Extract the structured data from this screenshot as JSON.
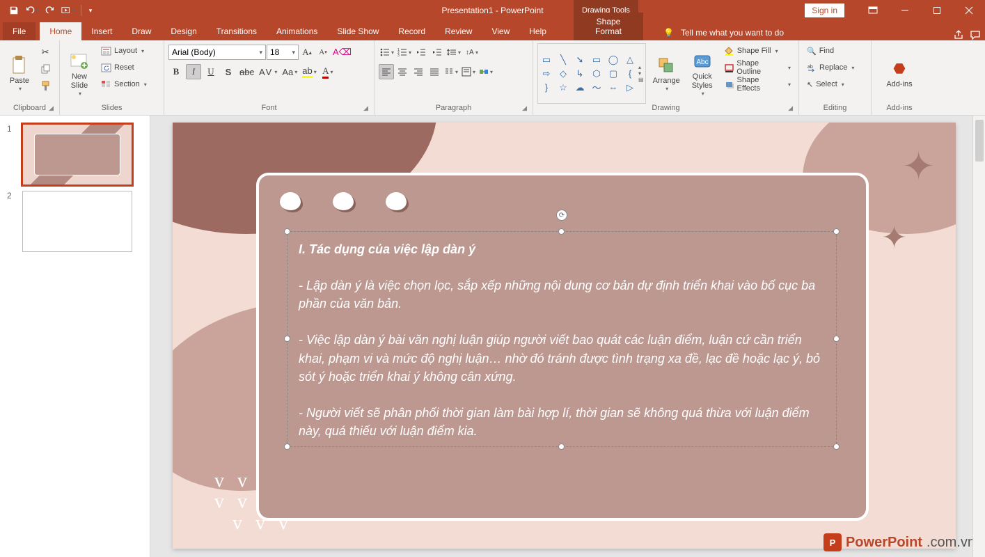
{
  "titlebar": {
    "document_title": "Presentation1 - PowerPoint",
    "context_tab": "Drawing Tools",
    "signin": "Sign in"
  },
  "tabs": {
    "file": "File",
    "items": [
      "Home",
      "Insert",
      "Draw",
      "Design",
      "Transitions",
      "Animations",
      "Slide Show",
      "Record",
      "Review",
      "View",
      "Help"
    ],
    "format": "Shape Format",
    "tellme": "Tell me what you want to do"
  },
  "ribbon": {
    "clipboard": {
      "label": "Clipboard",
      "paste": "Paste"
    },
    "slides": {
      "label": "Slides",
      "new_slide": "New\nSlide",
      "layout": "Layout",
      "reset": "Reset",
      "section": "Section"
    },
    "font": {
      "label": "Font",
      "name": "Arial (Body)",
      "size": "18"
    },
    "paragraph": {
      "label": "Paragraph"
    },
    "drawing": {
      "label": "Drawing",
      "arrange": "Arrange",
      "quick": "Quick\nStyles",
      "fill": "Shape Fill",
      "outline": "Shape Outline",
      "effects": "Shape Effects"
    },
    "editing": {
      "label": "Editing",
      "find": "Find",
      "replace": "Replace",
      "select": "Select"
    },
    "addins": {
      "label": "Add-ins",
      "btn": "Add-ins"
    }
  },
  "thumbs": {
    "n1": "1",
    "n2": "2"
  },
  "slide": {
    "heading": "I. Tác dụng của việc lập dàn ý",
    "p1": "- Lập dàn ý là việc chọn lọc, sắp xếp những nội dung cơ bản dự định triển khai vào bố cục ba phần của văn bản.",
    "p2": "- Việc lập dàn ý bài văn nghị luận giúp người viết bao quát các luận điểm, luận cứ cần triển khai, phạm vi và mức độ nghị luận… nhờ đó tránh được tình trạng xa đề, lạc đề hoặc lạc ý, bỏ sót ý hoặc triển khai ý không cân xứng.",
    "p3": "- Người viết sẽ phân phối thời gian làm bài hợp lí, thời gian sẽ không quá thừa với luận điểm này, quá thiếu với luận điểm kia."
  },
  "watermark": {
    "brand": "PowerPoint",
    "domain": ".com.vn"
  }
}
